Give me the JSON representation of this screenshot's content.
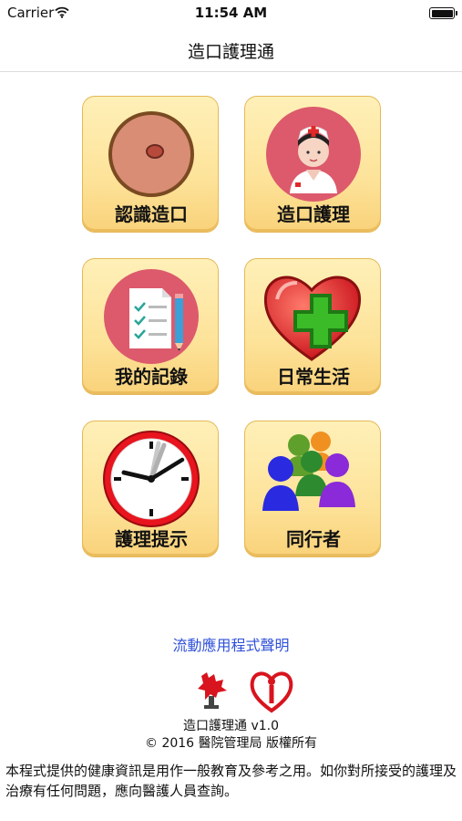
{
  "status_bar": {
    "carrier": "Carrier",
    "time": "11:54 AM"
  },
  "nav": {
    "title": "造口護理通"
  },
  "menu": [
    {
      "label": "認識造口",
      "icon": "stoma-icon"
    },
    {
      "label": "造口護理",
      "icon": "nurse-icon"
    },
    {
      "label": "我的記錄",
      "icon": "checklist-icon"
    },
    {
      "label": "日常生活",
      "icon": "heart-plus-icon"
    },
    {
      "label": "護理提示",
      "icon": "clock-icon"
    },
    {
      "label": "同行者",
      "icon": "people-icon"
    }
  ],
  "footer": {
    "app_statement_link": "流動應用程式聲明",
    "version": "造口護理通 v1.0",
    "copyright": "© 2016 醫院管理局 版權所有",
    "disclaimer": "本程式提供的健康資訊是用作一般教育及參考之用。如你對所接受的護理及治療有任何問題，應向醫護人員查詢。"
  },
  "colors": {
    "tile_bg": "#fde39a",
    "link": "#3050d8",
    "icon_circle": "#dc5a6c"
  }
}
